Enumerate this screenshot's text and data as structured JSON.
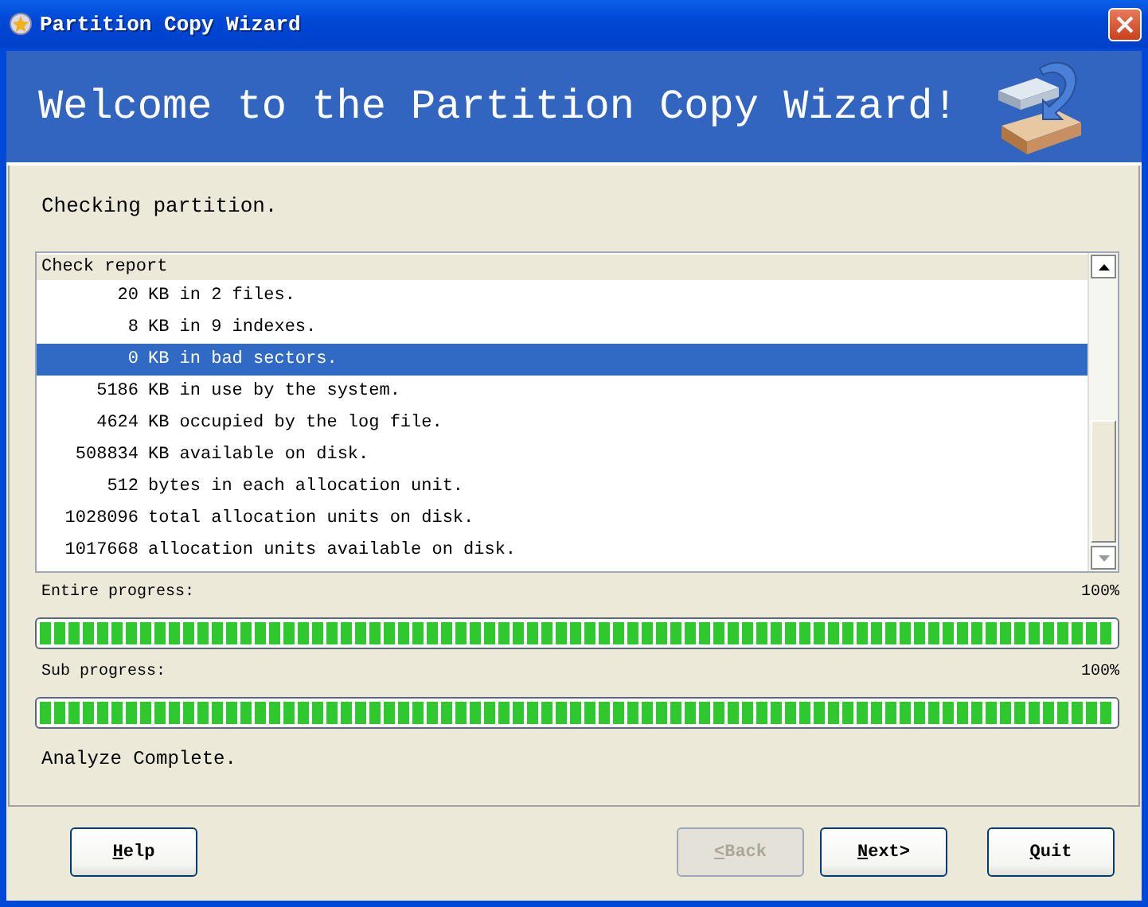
{
  "window": {
    "title": "Partition Copy Wizard"
  },
  "banner": {
    "title": "Welcome to the Partition Copy Wizard!"
  },
  "step_text": "Checking partition.",
  "report": {
    "header": "Check report",
    "rows": [
      {
        "number": "20",
        "text": "KB in 2 files.",
        "selected": false
      },
      {
        "number": "8",
        "text": "KB in 9 indexes.",
        "selected": false
      },
      {
        "number": "0",
        "text": "KB in bad sectors.",
        "selected": true
      },
      {
        "number": "5186",
        "text": "KB in use by the system.",
        "selected": false
      },
      {
        "number": "4624",
        "text": "KB occupied by the log file.",
        "selected": false
      },
      {
        "number": "508834",
        "text": "KB available on disk.",
        "selected": false
      },
      {
        "number": "512",
        "text": "bytes in each allocation unit.",
        "selected": false
      },
      {
        "number": "1028096",
        "text": "total allocation units on disk.",
        "selected": false
      },
      {
        "number": "1017668",
        "text": "allocation units available on disk.",
        "selected": false
      }
    ]
  },
  "progress": [
    {
      "label": "Entire progress:",
      "reading": "100%",
      "level": 1
    },
    {
      "label": "Sub progress:",
      "reading": "100%",
      "level": 1
    }
  ],
  "status": "Analyze Complete.",
  "buttons": [
    {
      "label": "Help",
      "disabled": false
    },
    {
      "label": "<Back",
      "disabled": true
    },
    {
      "label": "Next>",
      "disabled": false
    },
    {
      "label": "Quit",
      "disabled": false
    }
  ]
}
